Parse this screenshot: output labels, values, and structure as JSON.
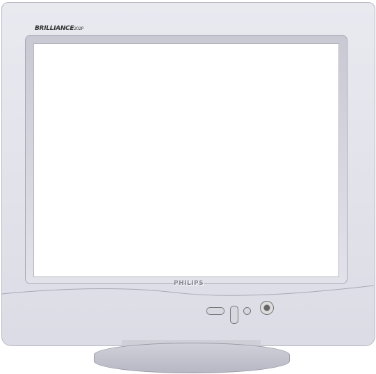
{
  "monitor": {
    "model_name": "BRILLIANCE",
    "model_number": "202P",
    "brand_logo": "PHILIPS",
    "colors": {
      "bezel": "#e4e4ec",
      "screen": "#ffffff"
    }
  }
}
